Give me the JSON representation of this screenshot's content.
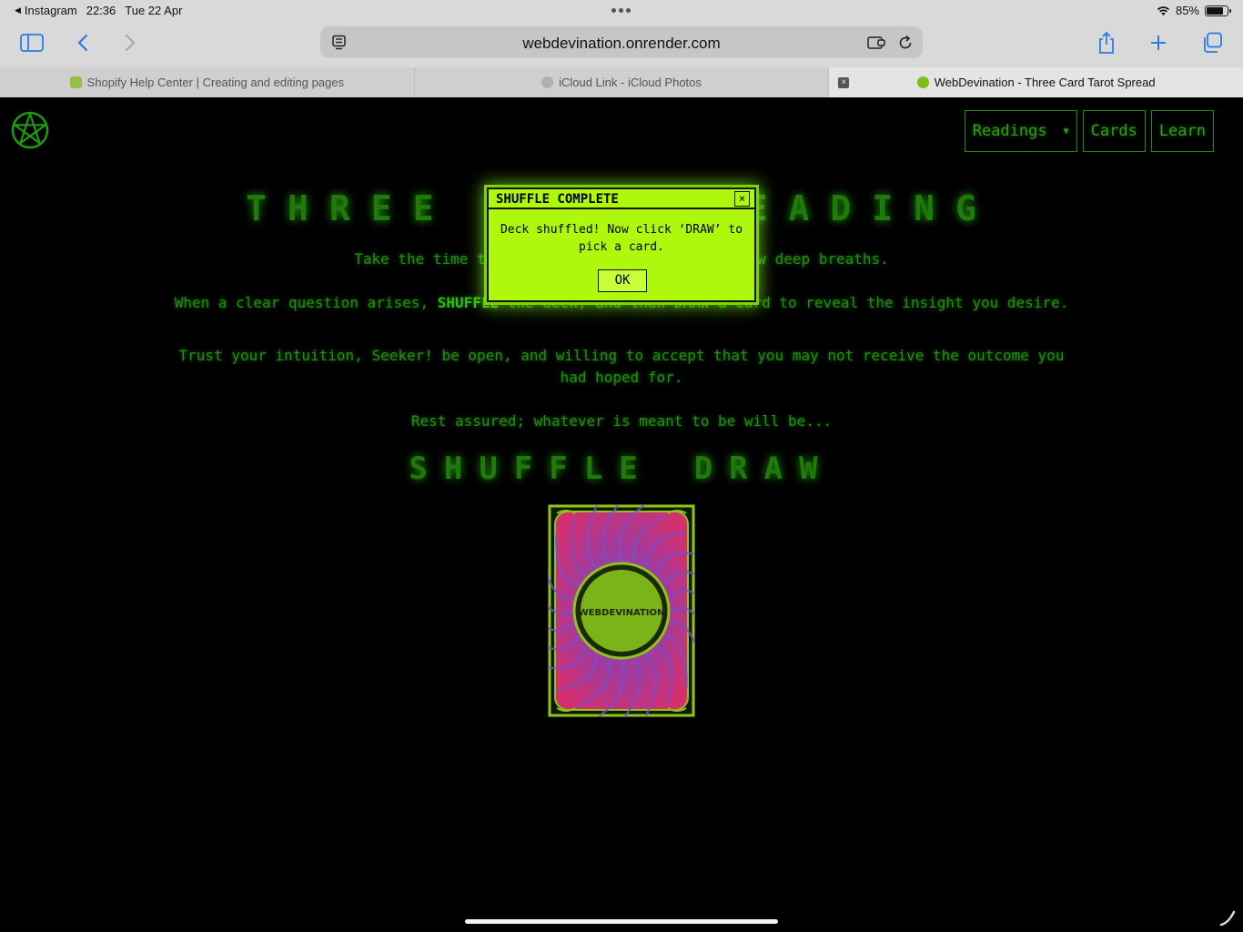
{
  "status_bar": {
    "back_app": "Instagram",
    "time": "22:36",
    "date": "Tue 22 Apr",
    "battery_percent": "85%",
    "battery_level": 0.85
  },
  "browser": {
    "url": "webdevination.onrender.com",
    "tabs": [
      {
        "title": "Shopify Help Center | Creating and editing pages",
        "active": false,
        "favicon_color": "#95bf47"
      },
      {
        "title": "iCloud Link - iCloud Photos",
        "active": false,
        "favicon_color": "#b0b0b0"
      },
      {
        "title": "WebDevination - Three Card Tarot Spread",
        "active": true,
        "favicon_color": "#7cbf1a"
      }
    ],
    "icons": [
      "sidebar-icon",
      "back-chevron-icon",
      "forward-chevron-icon",
      "reader-icon",
      "extension-icon",
      "reload-icon",
      "share-icon",
      "new-tab-plus-icon",
      "tabs-overview-icon"
    ]
  },
  "site": {
    "nav": {
      "readings": "Readings",
      "cards": "Cards",
      "learn": "Learn"
    },
    "title": "THREE CARD READING",
    "paragraphs": [
      "Take the time to center yourself and take a few deep breaths.",
      "When a clear question arises, SHUFFLE the deck, and then DRAW a card to reveal the insight you desire.",
      "Trust your intuition, Seeker! be open, and willing to accept that you may not receive the outcome you had hoped for.",
      "Rest assured; whatever is meant to be will be..."
    ],
    "para2_pre": "When a clear question arises, ",
    "para2_shuffle": "SHUFFLE",
    "para2_post": " the deck, and then DRAW a card to reveal the insight you desire.",
    "shuffle_label": "SHUFFLE",
    "draw_label": "DRAW",
    "card_back_text": "WEBDEVINATION",
    "colors": {
      "neon_green": "#33cc12",
      "modal_bg": "#aef80d",
      "card_pink": "#d4306e",
      "card_purple": "#7a4fc8"
    }
  },
  "modal": {
    "title": "SHUFFLE COMPLETE",
    "close_glyph": "×",
    "message": "Deck shuffled! Now click ‘DRAW’ to pick a card.",
    "ok_label": "OK"
  }
}
